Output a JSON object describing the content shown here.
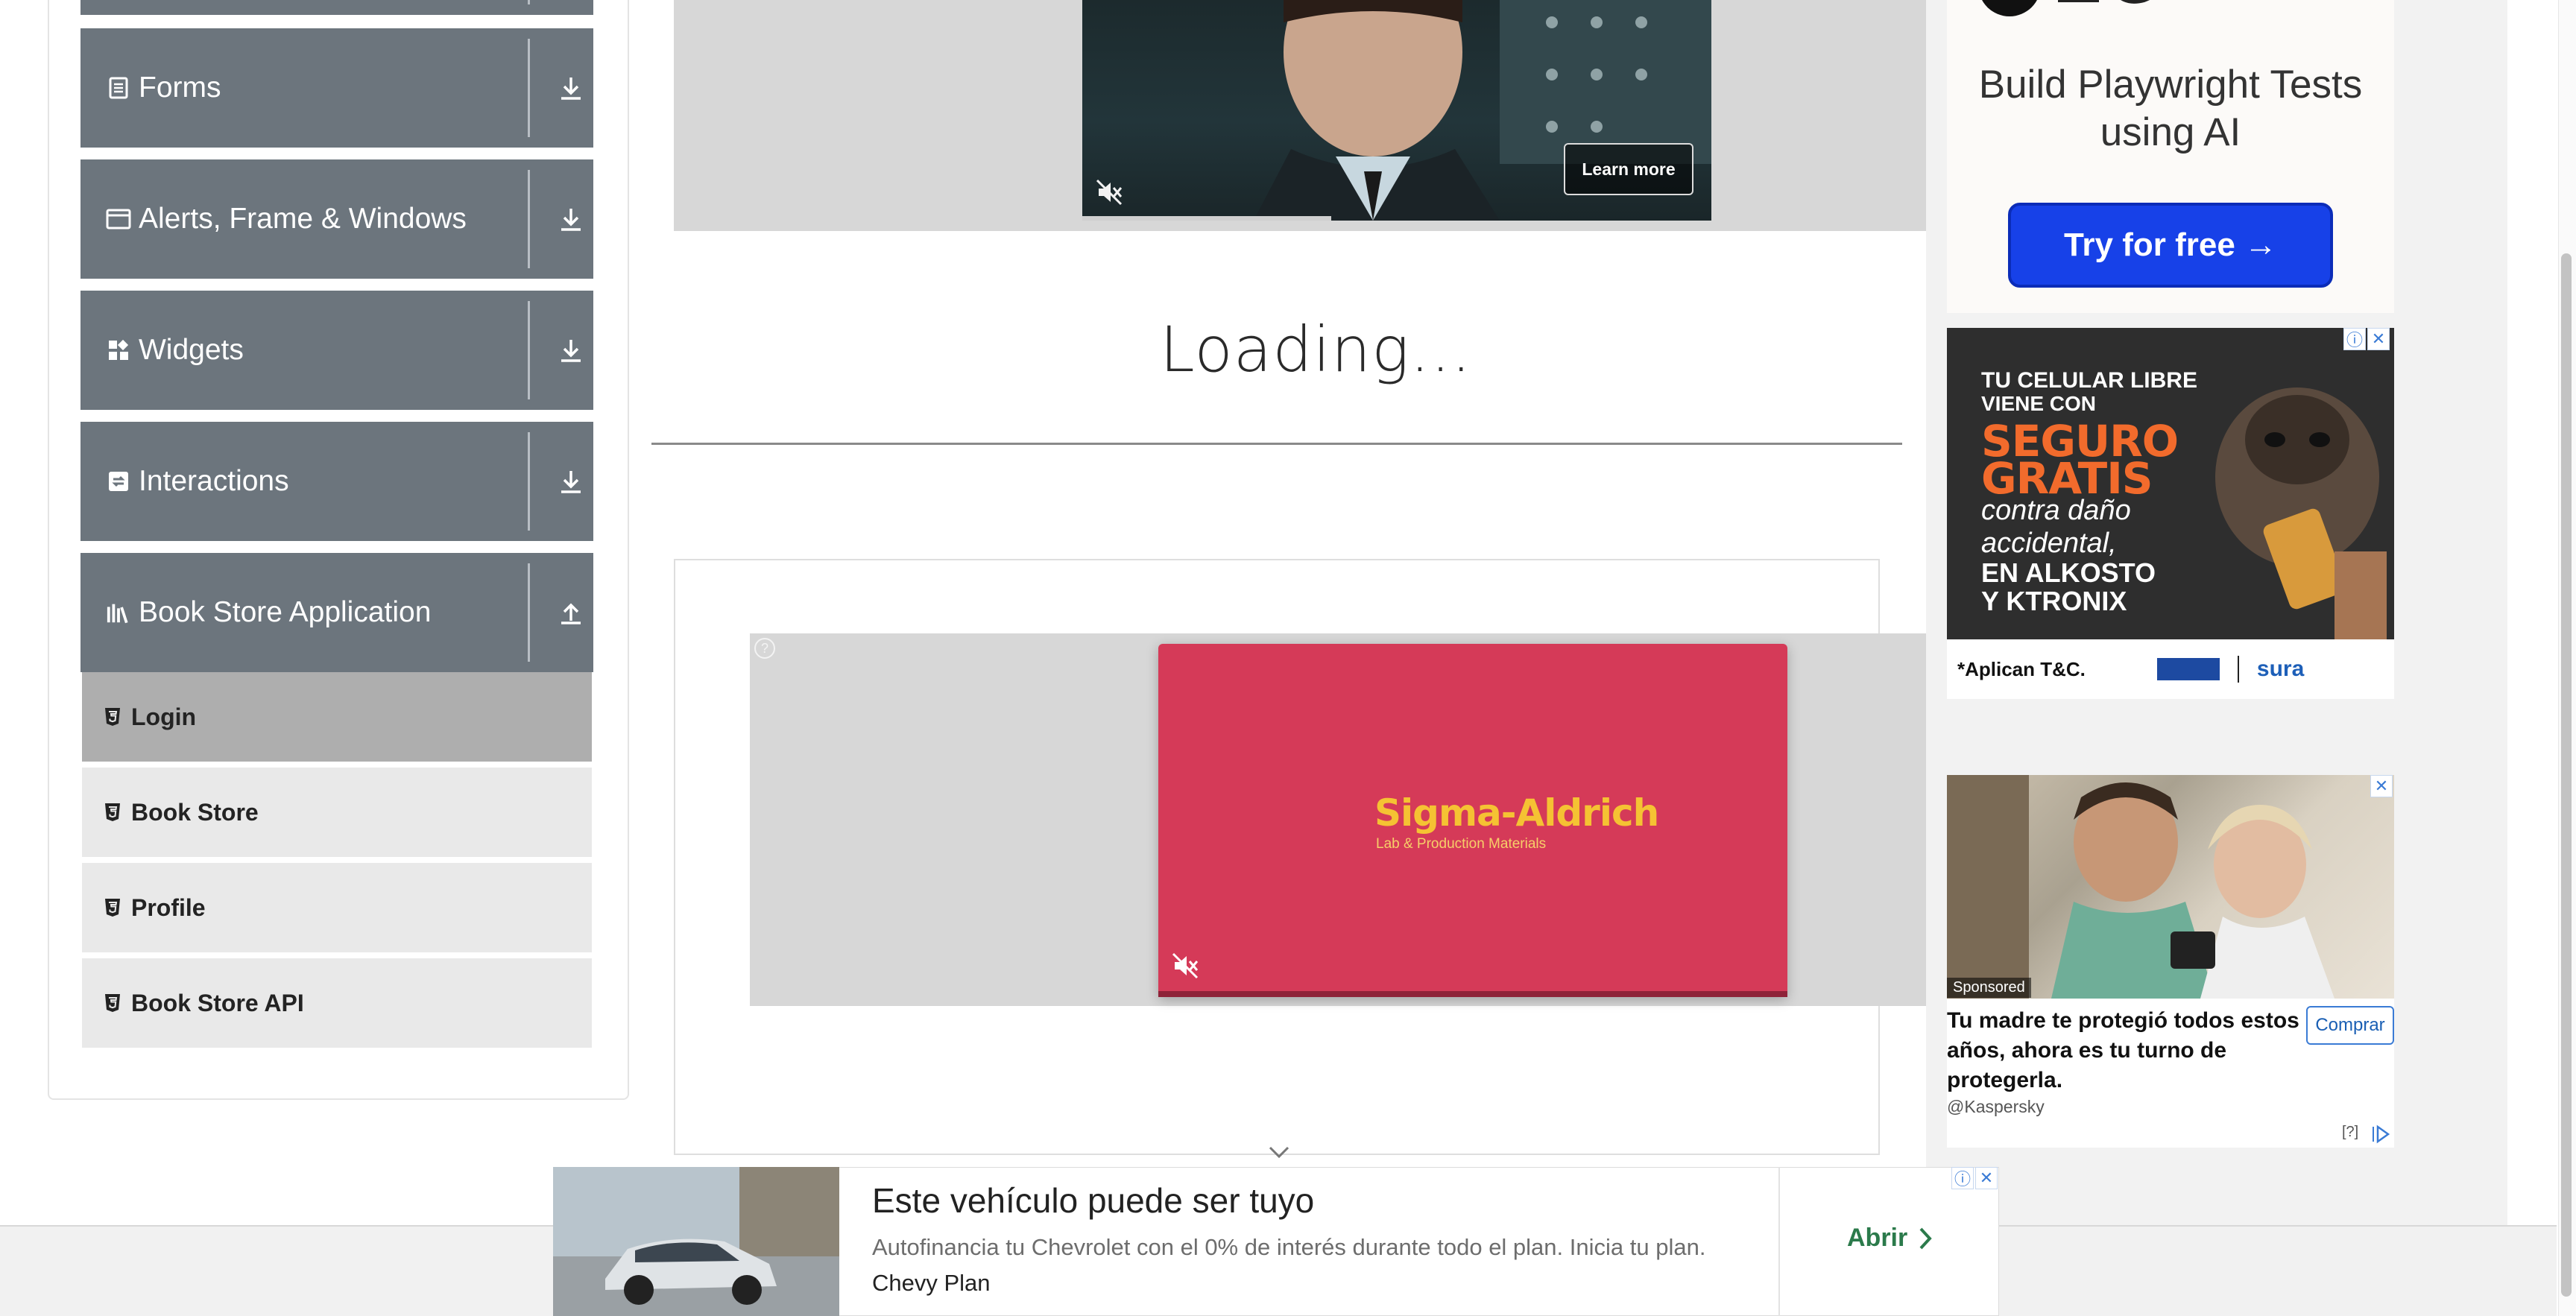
{
  "sidebar": {
    "groups": [
      {
        "label": "Forms",
        "icon": "document-icon",
        "arrow": "down"
      },
      {
        "label": "Alerts, Frame & Windows",
        "icon": "window-icon",
        "arrow": "down"
      },
      {
        "label": "Widgets",
        "icon": "widgets-icon",
        "arrow": "down"
      },
      {
        "label": "Interactions",
        "icon": "interactions-icon",
        "arrow": "down"
      },
      {
        "label": "Book Store Application",
        "icon": "books-icon",
        "arrow": "up"
      }
    ],
    "items": [
      {
        "label": "Login",
        "active": true
      },
      {
        "label": "Book Store",
        "active": false
      },
      {
        "label": "Profile",
        "active": false
      },
      {
        "label": "Book Store API",
        "active": false
      }
    ]
  },
  "main": {
    "video_ad": {
      "learn_more": "Learn more"
    },
    "loading_text": "Loading...",
    "sigma_ad": {
      "brand": "Sigma-Aldrich",
      "tagline": "Lab & Production Materials",
      "help": "?"
    }
  },
  "right_ads": {
    "ad1": {
      "title": "Build Playwright Tests using AI",
      "button": "Try for free →"
    },
    "ad2": {
      "line1": "TU CELULAR LIBRE",
      "line2": "VIENE CON",
      "line3": "SEGURO",
      "line4": "GRATIS",
      "line5": "contra daño",
      "line6": "accidental,",
      "line7": "EN ALKOSTO",
      "line8": "Y KTRONIX",
      "footer_note": "*Aplican T&C.",
      "footer_brand": "sura"
    },
    "ad3": {
      "sponsored": "Sponsored",
      "headline": "Tu madre te protegió todos estos años, ahora es tu turno de protegerla.",
      "domain": "@Kaspersky",
      "button": "Comprar",
      "meta": "[?]"
    }
  },
  "bottom_ad": {
    "title": "Este vehículo puede ser tuyo",
    "description": "Autofinancia tu Chevrolet con el 0% de interés durante todo el plan. Inicia tu plan.",
    "brand": "Chevy Plan",
    "cta": "Abrir"
  },
  "colors": {
    "sidebar_header": "#6c757d",
    "sidebar_item": "#e9e9e9",
    "sidebar_item_active": "#aeaeae",
    "cta_blue": "#1741e8",
    "sigma_red": "#d53a58",
    "abrir_green": "#2b7a4b"
  }
}
